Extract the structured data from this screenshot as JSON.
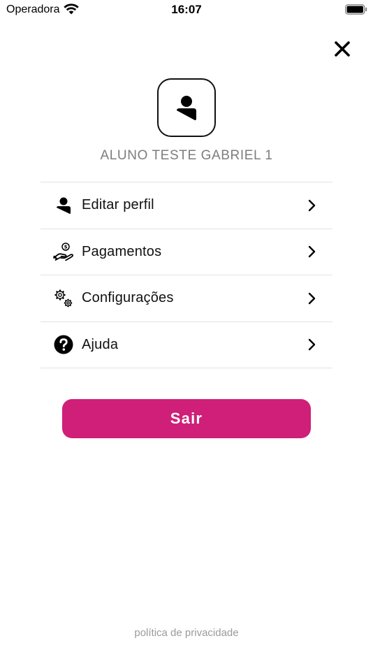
{
  "status_bar": {
    "carrier": "Operadora",
    "time": "16:07"
  },
  "profile": {
    "name": "ALUNO TESTE GABRIEL 1"
  },
  "menu": {
    "items": [
      {
        "label": "Editar perfil",
        "icon": "user-icon"
      },
      {
        "label": "Pagamentos",
        "icon": "payment-hand-icon"
      },
      {
        "label": "Configurações",
        "icon": "gears-icon"
      },
      {
        "label": "Ajuda",
        "icon": "help-circle-icon"
      }
    ]
  },
  "actions": {
    "logout_label": "Sair",
    "privacy_label": "política de privacidade"
  },
  "colors": {
    "accent": "#cf1f78",
    "name_gray": "#7d7d7d",
    "divider": "#e2e2e2",
    "privacy_gray": "#9a9a9a"
  }
}
